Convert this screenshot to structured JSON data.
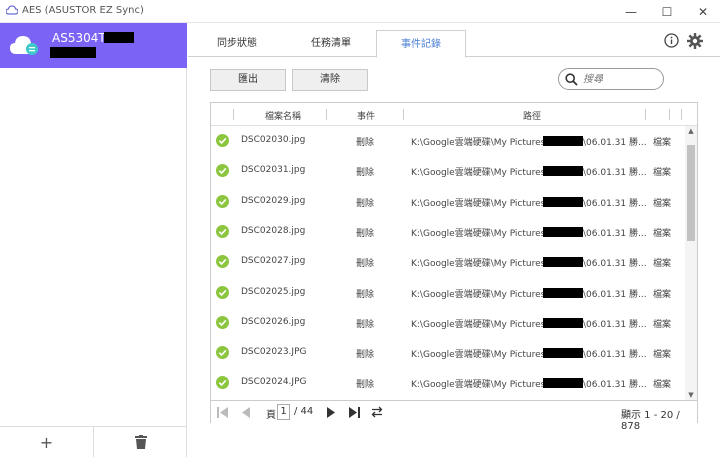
{
  "window": {
    "title": "AES (ASUSTOR EZ Sync)",
    "minimize_icon": "—",
    "maximize_icon": "☐",
    "close_icon": "✕"
  },
  "sidebar": {
    "device_name": "AS5304T-",
    "add_icon": "+",
    "delete_icon": "🗑"
  },
  "tabs": [
    {
      "label": "同步狀態"
    },
    {
      "label": "任務清單"
    },
    {
      "label": "事件記錄"
    }
  ],
  "toolbar": {
    "export_label": "匯出",
    "clear_label": "清除",
    "search_placeholder": "搜尋"
  },
  "table": {
    "columns": [
      "檔案名稱",
      "事件",
      "路徑"
    ],
    "rows": [
      {
        "file": "DSC02030.jpg",
        "event": "刪除",
        "path_prefix": "K:\\Google雲端硬碟\\My Pictures\\",
        "path_suffix": "\\06.01.31 勝...",
        "type": "檔案"
      },
      {
        "file": "DSC02031.jpg",
        "event": "刪除",
        "path_prefix": "K:\\Google雲端硬碟\\My Pictures\\",
        "path_suffix": "\\06.01.31 勝...",
        "type": "檔案"
      },
      {
        "file": "DSC02029.jpg",
        "event": "刪除",
        "path_prefix": "K:\\Google雲端硬碟\\My Pictures\\",
        "path_suffix": "\\06.01.31 勝...",
        "type": "檔案"
      },
      {
        "file": "DSC02028.jpg",
        "event": "刪除",
        "path_prefix": "K:\\Google雲端硬碟\\My Pictures\\",
        "path_suffix": "\\06.01.31 勝...",
        "type": "檔案"
      },
      {
        "file": "DSC02027.jpg",
        "event": "刪除",
        "path_prefix": "K:\\Google雲端硬碟\\My Pictures\\",
        "path_suffix": "\\06.01.31 勝...",
        "type": "檔案"
      },
      {
        "file": "DSC02025.jpg",
        "event": "刪除",
        "path_prefix": "K:\\Google雲端硬碟\\My Pictures\\",
        "path_suffix": "\\06.01.31 勝...",
        "type": "檔案"
      },
      {
        "file": "DSC02026.jpg",
        "event": "刪除",
        "path_prefix": "K:\\Google雲端硬碟\\My Pictures\\",
        "path_suffix": "\\06.01.31 勝...",
        "type": "檔案"
      },
      {
        "file": "DSC02023.JPG",
        "event": "刪除",
        "path_prefix": "K:\\Google雲端硬碟\\My Pictures\\",
        "path_suffix": "\\06.01.31 勝...",
        "type": "檔案"
      },
      {
        "file": "DSC02024.JPG",
        "event": "刪除",
        "path_prefix": "K:\\Google雲端硬碟\\My Pictures\\",
        "path_suffix": "\\06.01.31 勝...",
        "type": "檔案"
      }
    ]
  },
  "pager": {
    "page_label": "頁",
    "current_page": "1",
    "total_pages": "/ 44",
    "status": "顯示 1 - 20 / 878"
  },
  "colors": {
    "accent": "#7a63f5",
    "active_tab": "#4a7fd6",
    "success": "#8cc63f"
  }
}
